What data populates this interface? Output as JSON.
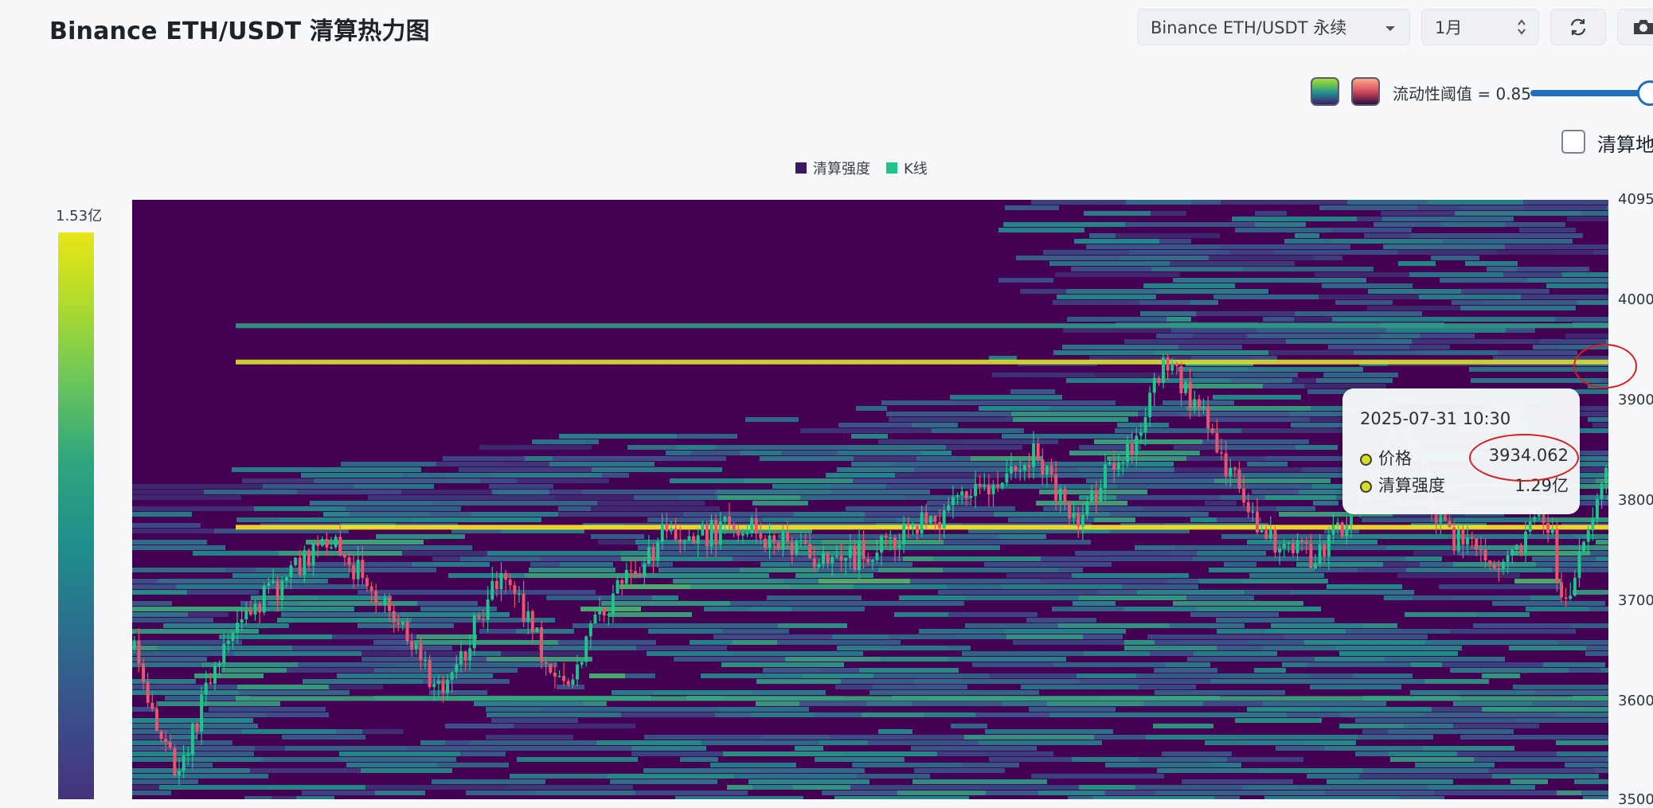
{
  "page": {
    "title": "Binance ETH/USDT 清算热力图"
  },
  "controls": {
    "symbol_select": "Binance ETH/USDT 永续",
    "period_select": "1月",
    "refresh_icon": "refresh-icon",
    "camera_icon": "camera-icon",
    "colormap_options": [
      "viridis",
      "magma"
    ],
    "threshold_label": "流动性阈值 = 0.85",
    "liquidity_threshold": 0.85,
    "checkbox_label": "清算地"
  },
  "legend": {
    "items": [
      "清算强度",
      "K线"
    ]
  },
  "colorbar": {
    "max_label": "1.53亿"
  },
  "chart_data": {
    "type": "heatmap",
    "legend": [
      "清算强度",
      "K线"
    ],
    "y_ticks": [
      "4095",
      "4000",
      "3900",
      "3800",
      "3700",
      "3600",
      "3500"
    ],
    "ylim": [
      3500,
      4095
    ],
    "colorbar_max": "1.53亿",
    "colors": {
      "low": "#440154",
      "mid": "#21918c",
      "high": "#fde725",
      "up_candle": "#1fc58a",
      "down_candle": "#e8566e"
    },
    "price_path_approx": [
      {
        "t": 0.0,
        "price": 3650
      },
      {
        "t": 0.03,
        "price": 3520
      },
      {
        "t": 0.06,
        "price": 3650
      },
      {
        "t": 0.09,
        "price": 3700
      },
      {
        "t": 0.13,
        "price": 3760
      },
      {
        "t": 0.17,
        "price": 3700
      },
      {
        "t": 0.21,
        "price": 3600
      },
      {
        "t": 0.25,
        "price": 3730
      },
      {
        "t": 0.29,
        "price": 3610
      },
      {
        "t": 0.32,
        "price": 3690
      },
      {
        "t": 0.36,
        "price": 3760
      },
      {
        "t": 0.42,
        "price": 3770
      },
      {
        "t": 0.47,
        "price": 3730
      },
      {
        "t": 0.52,
        "price": 3760
      },
      {
        "t": 0.56,
        "price": 3790
      },
      {
        "t": 0.61,
        "price": 3840
      },
      {
        "t": 0.64,
        "price": 3780
      },
      {
        "t": 0.68,
        "price": 3860
      },
      {
        "t": 0.7,
        "price": 3935
      },
      {
        "t": 0.73,
        "price": 3870
      },
      {
        "t": 0.76,
        "price": 3770
      },
      {
        "t": 0.8,
        "price": 3740
      },
      {
        "t": 0.83,
        "price": 3790
      },
      {
        "t": 0.86,
        "price": 3880
      },
      {
        "t": 0.89,
        "price": 3760
      },
      {
        "t": 0.93,
        "price": 3740
      },
      {
        "t": 0.96,
        "price": 3780
      },
      {
        "t": 0.97,
        "price": 3680
      },
      {
        "t": 1.0,
        "price": 3850
      }
    ],
    "highlight_levels": [
      {
        "price": 3770,
        "intensity": 1.0
      },
      {
        "price": 3934,
        "intensity": 0.95
      },
      {
        "price": 3970,
        "intensity": 0.55
      },
      {
        "price": 3600,
        "intensity": 0.6
      }
    ]
  },
  "tooltip": {
    "time": "2025-07-31 10:30",
    "price_label": "价格",
    "price_value": "3934.062",
    "intensity_label": "清算强度",
    "intensity_value": "1.29亿"
  }
}
